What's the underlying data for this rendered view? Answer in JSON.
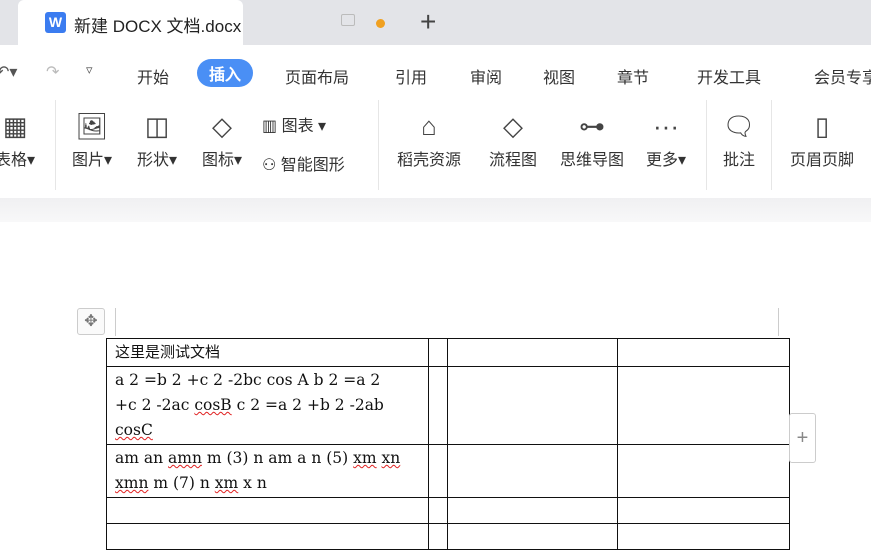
{
  "tab": {
    "title": "新建 DOCX 文档.docx",
    "logo": "W"
  },
  "menu": [
    "开始",
    "插入",
    "页面布局",
    "引用",
    "审阅",
    "视图",
    "章节",
    "开发工具",
    "会员专享"
  ],
  "ribbon": {
    "table": "表格",
    "picture": "图片",
    "shape": "形状",
    "icon": "图标",
    "chart": "图表",
    "smart": "智能图形",
    "daoke": "稻壳资源",
    "flow": "流程图",
    "mind": "思维导图",
    "more": "更多",
    "comment": "批注",
    "header": "页眉页脚"
  },
  "doc": {
    "rows": [
      [
        "这里是测试文档"
      ],
      [
        "a 2 =b 2 +c 2 -2bc cos A b 2 =a 2",
        "+c 2 -2ac ",
        "cosB",
        " c 2 =a 2 +b 2 -2ab",
        "cosC"
      ],
      [
        "am an ",
        "amn",
        " m (3) n am a n (5) ",
        "xm",
        " ",
        "xn",
        "xmn",
        " m (7) n ",
        "xm",
        " x n"
      ]
    ]
  }
}
